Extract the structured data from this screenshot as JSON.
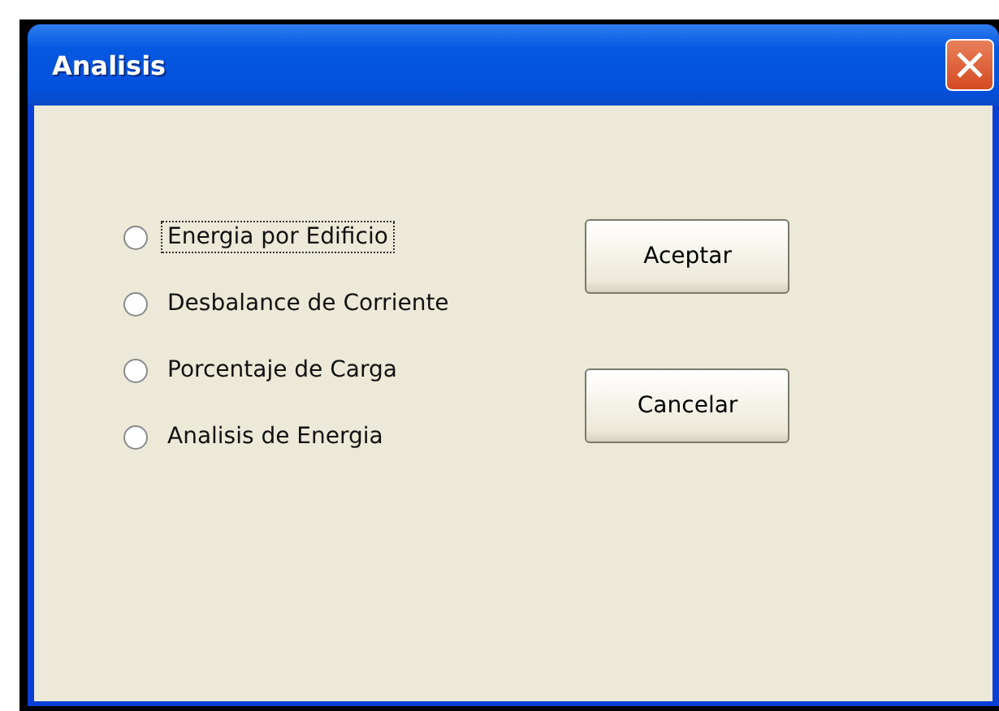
{
  "window": {
    "title": "Analisis"
  },
  "options": [
    {
      "label": "Energia por Edificio",
      "selected": false,
      "focused": true
    },
    {
      "label": "Desbalance de Corriente",
      "selected": false,
      "focused": false
    },
    {
      "label": "Porcentaje de Carga",
      "selected": false,
      "focused": false
    },
    {
      "label": "Analisis de Energia",
      "selected": false,
      "focused": false
    }
  ],
  "buttons": [
    "Aceptar",
    "Cancelar"
  ]
}
